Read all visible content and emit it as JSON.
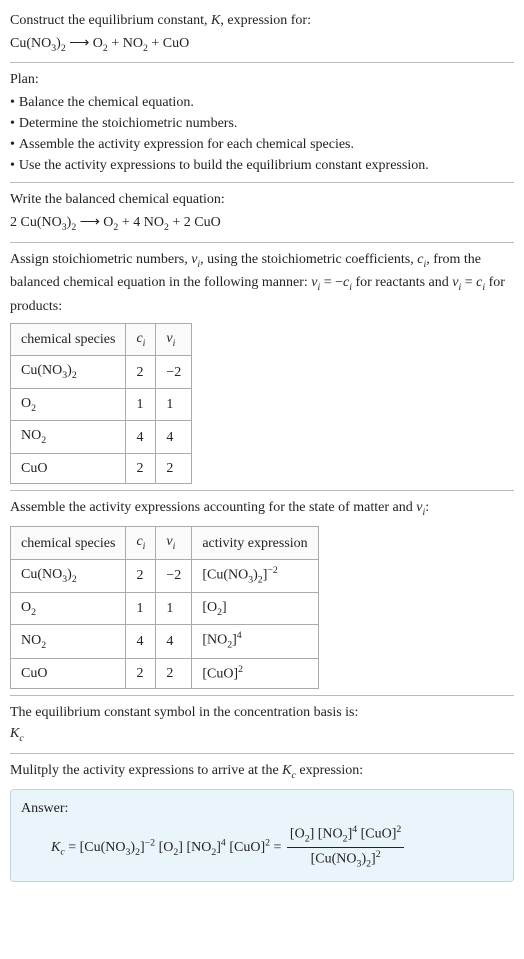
{
  "intro": {
    "prompt_prefix": "Construct the equilibrium constant, ",
    "prompt_K": "K",
    "prompt_suffix": ", expression for:"
  },
  "equation_unbalanced": {
    "lhs_1": "Cu(NO",
    "lhs_1_sub1": "3",
    "lhs_1_mid": ")",
    "lhs_1_sub2": "2",
    "arrow": " ⟶ ",
    "rhs_1": "O",
    "rhs_1_sub": "2",
    "plus1": " + ",
    "rhs_2": "NO",
    "rhs_2_sub": "2",
    "plus2": " + ",
    "rhs_3": "CuO"
  },
  "plan": {
    "label": "Plan:",
    "items": [
      "Balance the chemical equation.",
      "Determine the stoichiometric numbers.",
      "Assemble the activity expression for each chemical species.",
      "Use the activity expressions to build the equilibrium constant expression."
    ]
  },
  "balanced": {
    "label": "Write the balanced chemical equation:",
    "coef1": "2 ",
    "sp1": "Cu(NO",
    "sp1_sub1": "3",
    "sp1_mid": ")",
    "sp1_sub2": "2",
    "arrow": " ⟶ ",
    "sp2": "O",
    "sp2_sub": "2",
    "plus1": " + ",
    "coef3": "4 ",
    "sp3": "NO",
    "sp3_sub": "2",
    "plus2": " + ",
    "coef4": "2 ",
    "sp4": "CuO"
  },
  "stoich_text": {
    "p1": "Assign stoichiometric numbers, ",
    "nu": "ν",
    "sub_i": "i",
    "p2": ", using the stoichiometric coefficients, ",
    "c": "c",
    "p3": ", from the balanced chemical equation in the following manner: ",
    "eq1_lhs": " = −",
    "p4": " for reactants and ",
    "eq2_mid": " = ",
    "p5": " for products:"
  },
  "table1": {
    "headers": {
      "species": "chemical species",
      "ci": "c",
      "ci_sub": "i",
      "nui": "ν",
      "nui_sub": "i"
    },
    "rows": [
      {
        "sp_html": "Cu(NO<span class=\"sub\">3</span>)<span class=\"sub\">2</span>",
        "c": "2",
        "nu": "−2"
      },
      {
        "sp_html": "O<span class=\"sub\">2</span>",
        "c": "1",
        "nu": "1"
      },
      {
        "sp_html": "NO<span class=\"sub\">2</span>",
        "c": "4",
        "nu": "4"
      },
      {
        "sp_html": "CuO",
        "c": "2",
        "nu": "2"
      }
    ]
  },
  "activity_text": {
    "p1": "Assemble the activity expressions accounting for the state of matter and ",
    "nu": "ν",
    "sub_i": "i",
    "p2": ":"
  },
  "table2": {
    "headers": {
      "species": "chemical species",
      "ci": "c",
      "ci_sub": "i",
      "nui": "ν",
      "nui_sub": "i",
      "act": "activity expression"
    },
    "rows": [
      {
        "sp_html": "Cu(NO<span class=\"sub\">3</span>)<span class=\"sub\">2</span>",
        "c": "2",
        "nu": "−2",
        "act_html": "[Cu(NO<span class=\"sub\">3</span>)<span class=\"sub\">2</span>]<span class=\"sup\">−2</span>"
      },
      {
        "sp_html": "O<span class=\"sub\">2</span>",
        "c": "1",
        "nu": "1",
        "act_html": "[O<span class=\"sub\">2</span>]"
      },
      {
        "sp_html": "NO<span class=\"sub\">2</span>",
        "c": "4",
        "nu": "4",
        "act_html": "[NO<span class=\"sub\">2</span>]<span class=\"sup\">4</span>"
      },
      {
        "sp_html": "CuO",
        "c": "2",
        "nu": "2",
        "act_html": "[CuO]<span class=\"sup\">2</span>"
      }
    ]
  },
  "kc_symbol": {
    "line1": "The equilibrium constant symbol in the concentration basis is:",
    "K": "K",
    "sub_c": "c"
  },
  "multiply": {
    "p1": "Mulitply the activity expressions to arrive at the ",
    "K": "K",
    "sub_c": "c",
    "p2": " expression:"
  },
  "answer": {
    "label": "Answer:",
    "K": "K",
    "sub_c": "c",
    "eq": " = ",
    "term1_html": "[Cu(NO<span class=\"sub\">3</span>)<span class=\"sub\">2</span>]<span class=\"sup\">−2</span>",
    "sp": " ",
    "term2_html": "[O<span class=\"sub\">2</span>]",
    "term3_html": "[NO<span class=\"sub\">2</span>]<span class=\"sup\">4</span>",
    "term4_html": "[CuO]<span class=\"sup\">2</span>",
    "eq2": " = ",
    "frac_num_html": "[O<span class=\"sub\">2</span>] [NO<span class=\"sub\">2</span>]<span class=\"sup\">4</span> [CuO]<span class=\"sup\">2</span>",
    "frac_den_html": "[Cu(NO<span class=\"sub\">3</span>)<span class=\"sub\">2</span>]<span class=\"sup\">2</span>"
  }
}
